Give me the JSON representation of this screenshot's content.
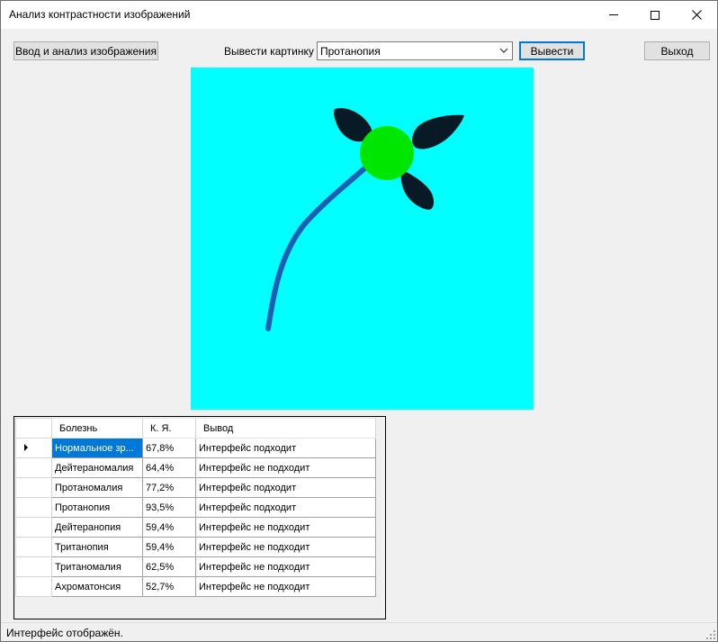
{
  "window": {
    "title": "Анализ контрастности изображений"
  },
  "toolbar": {
    "analyze_label": "Ввод и анализ изображения",
    "show_picture_label": "Вывести картинку",
    "combo_value": "Протанопия",
    "show_button_label": "Вывести",
    "exit_label": "Выход"
  },
  "picture": {
    "background_color": "#00ffff",
    "flower_center_color": "#00e600",
    "stem_color": "#1a5fb4",
    "leaf_color": "#071a26"
  },
  "grid": {
    "headers": [
      "Болезнь",
      "К. Я.",
      "Вывод"
    ],
    "rows": [
      {
        "name": "Нормальное зр...",
        "k": "67,8%",
        "result": "Интерфейс подходит"
      },
      {
        "name": "Дейтераномалия",
        "k": "64,4%",
        "result": "Интерфейс не подходит"
      },
      {
        "name": "Протаномалия",
        "k": "77,2%",
        "result": "Интерфейс подходит"
      },
      {
        "name": "Протанопия",
        "k": "93,5%",
        "result": "Интерфейс подходит"
      },
      {
        "name": "Дейтеранопия",
        "k": "59,4%",
        "result": "Интерфейс не подходит"
      },
      {
        "name": "Тританопия",
        "k": "59,4%",
        "result": "Интерфейс не подходит"
      },
      {
        "name": "Тританомалия",
        "k": "62,5%",
        "result": "Интерфейс не подходит"
      },
      {
        "name": "Ахроматонсия",
        "k": "52,7%",
        "result": "Интерфейс не подходит"
      }
    ]
  },
  "status": {
    "text": "Интерфейс отображён."
  },
  "icons": {
    "minimize": "minimize-icon",
    "maximize": "maximize-icon",
    "close": "close-icon",
    "dropdown": "chevron-down-icon",
    "row_pointer": "row-pointer-icon",
    "grip": "size-grip-icon"
  }
}
